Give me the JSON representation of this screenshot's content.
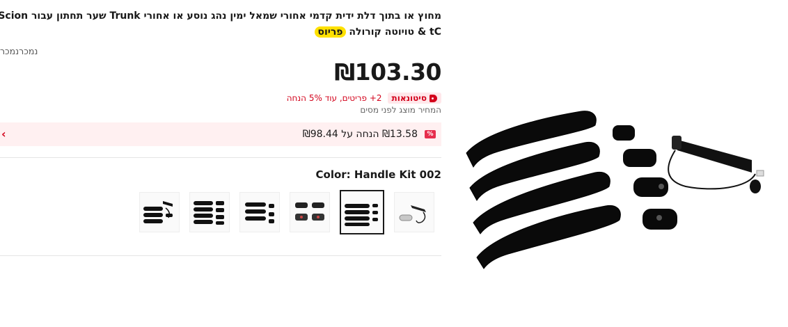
{
  "product": {
    "title_main": "מחוץ או בתוך דלת ידית קדמי אחורי שמאל ימין נהג נוסע או אחורי Trunk שער תחתון עבור Scion tC & טויוטה קורולה",
    "title_highlight": "פריוס",
    "sold_text": "נמכרנמכר",
    "price": "₪103.30",
    "bulk_badge": "סיטונאות",
    "bulk_text": "2+ פריטים, עוד 5% הנחה",
    "tax_note": "המחיר מוצג לפני מסים",
    "coupon_badge": "%",
    "coupon_text": "₪13.58 הנחה על ₪98.44",
    "coupon_chevron": "›",
    "color_label": "Color: Handle Kit 002"
  },
  "swatches": {
    "count": 6,
    "selected_index": 1
  },
  "colors": {
    "accent_red": "#d3031c",
    "highlight_yellow": "#ffe100",
    "coupon_bg": "#fff0f1"
  },
  "icons": {
    "tag": "tag-icon",
    "chevron": "chevron-right-icon"
  }
}
